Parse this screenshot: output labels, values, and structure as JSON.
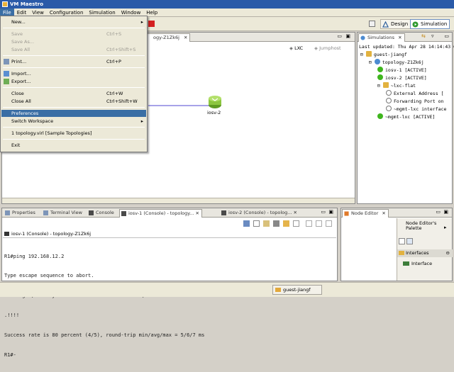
{
  "window": {
    "title": "VM Maestro"
  },
  "menubar": [
    "File",
    "Edit",
    "View",
    "Configuration",
    "Simulation",
    "Window",
    "Help"
  ],
  "file_menu": {
    "items": [
      {
        "label": "New...",
        "shortcut": "",
        "disabled": false,
        "submenu": true
      },
      {
        "label": "Save",
        "shortcut": "Ctrl+S",
        "disabled": true
      },
      {
        "label": "Save As...",
        "shortcut": "",
        "disabled": true
      },
      {
        "label": "Save All",
        "shortcut": "Ctrl+Shift+S",
        "disabled": true
      },
      {
        "label": "Print...",
        "shortcut": "Ctrl+P",
        "disabled": false
      },
      {
        "label": "Import...",
        "shortcut": "",
        "disabled": false
      },
      {
        "label": "Export...",
        "shortcut": "",
        "disabled": false
      },
      {
        "label": "Close",
        "shortcut": "Ctrl+W",
        "disabled": false
      },
      {
        "label": "Close All",
        "shortcut": "Ctrl+Shift+W",
        "disabled": false
      },
      {
        "label": "Preferences",
        "shortcut": "",
        "disabled": false,
        "selected": true
      },
      {
        "label": "Switch Workspace",
        "shortcut": "",
        "disabled": false,
        "submenu": true
      },
      {
        "label": "1 topology.virl  [Sample Topologies]",
        "shortcut": "",
        "disabled": false
      },
      {
        "label": "Exit",
        "shortcut": "",
        "disabled": false
      }
    ]
  },
  "perspectives": {
    "design": "Design",
    "simulation": "Simulation"
  },
  "editor": {
    "tab_label": "ogy-Z1Zk6j",
    "lxc_label": "LXC",
    "jumphost_label": "Jumphost",
    "node_label": "iosv-2"
  },
  "simulations_view": {
    "tab_label": "Simulations",
    "last_updated": "Last updated: Thu Apr 28 14:14:43 CS",
    "tree": [
      {
        "label": "guest-jiangf",
        "indent": 0,
        "icon": "folder"
      },
      {
        "label": "topology-Z1Zk6j",
        "indent": 1,
        "icon": "topology"
      },
      {
        "label": "iosv-1  [ACTIVE]",
        "indent": 2,
        "icon": "active"
      },
      {
        "label": "iosv-2  [ACTIVE]",
        "indent": 2,
        "icon": "active"
      },
      {
        "label": "~lxc-flat",
        "indent": 2,
        "icon": "folder"
      },
      {
        "label": "External Address  [",
        "indent": 3,
        "icon": "unknown"
      },
      {
        "label": "Forwarding Port on",
        "indent": 3,
        "icon": "unknown"
      },
      {
        "label": "~mgmt-lxc interface",
        "indent": 3,
        "icon": "unknown"
      },
      {
        "label": "~mgmt-lxc  [ACTIVE]",
        "indent": 2,
        "icon": "active"
      }
    ]
  },
  "bottom_tabs": [
    {
      "label": "Properties",
      "active": false
    },
    {
      "label": "Terminal View",
      "active": false
    },
    {
      "label": "Console",
      "active": false
    },
    {
      "label": "iosv-1 (Console) - topology...",
      "active": true
    },
    {
      "label": "iosv-2 (Console) - topolog...",
      "active": false
    }
  ],
  "console": {
    "header": "iosv-1 (Console) - topology-Z1Zk6j",
    "lines": [
      "R1#ping 192.168.12.2",
      "Type escape sequence to abort.",
      "Sending 5, 100-byte ICMP Echos to 192.168.12.2, timeout is 2 seconds:",
      ".!!!!",
      "Success rate is 80 percent (4/5), round-trip min/avg/max = 5/6/7 ms",
      "R1#-"
    ]
  },
  "node_editor": {
    "tab_label": "Node Editor",
    "palette_title": "Node Editor's Palette",
    "interfaces_group": "Interfaces",
    "interface_item": "Interface"
  },
  "statusbar": {
    "user": "guest-jiangf"
  },
  "colors": {
    "active_node": "#3fb51e",
    "selection": "#3a6ea5",
    "titlebar": "#2a5aa8",
    "link": "#a7a3e8"
  }
}
